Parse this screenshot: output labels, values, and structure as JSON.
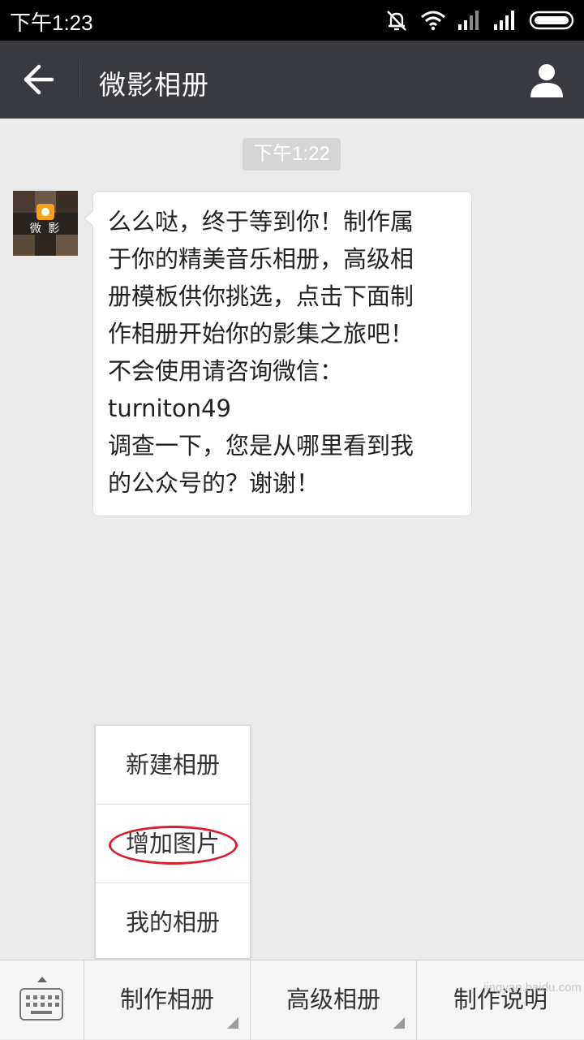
{
  "status_bar": {
    "time": "下午1:23"
  },
  "header": {
    "title": "微影相册"
  },
  "chat": {
    "timestamp": "下午1:22",
    "avatar_label": "微 影",
    "message_lines": [
      "么么哒，终于等到你！制作属",
      "于你的精美音乐相册，高级相",
      "册模板供你挑选，点击下面制",
      "作相册开始你的影集之旅吧！",
      "不会使用请咨询微信：",
      "turniton49",
      "调查一下，您是从哪里看到我",
      "的公众号的？谢谢！"
    ]
  },
  "popup_menu": {
    "items": [
      "新建相册",
      "增加图片",
      "我的相册"
    ]
  },
  "bottom_menu": {
    "tabs": [
      "制作相册",
      "高级相册",
      "制作说明"
    ]
  },
  "watermark": "jingyan.baidu.com",
  "colors": {
    "title_bar": "#393a3f",
    "background": "#ebebeb",
    "highlight_circle": "#d9202e"
  }
}
